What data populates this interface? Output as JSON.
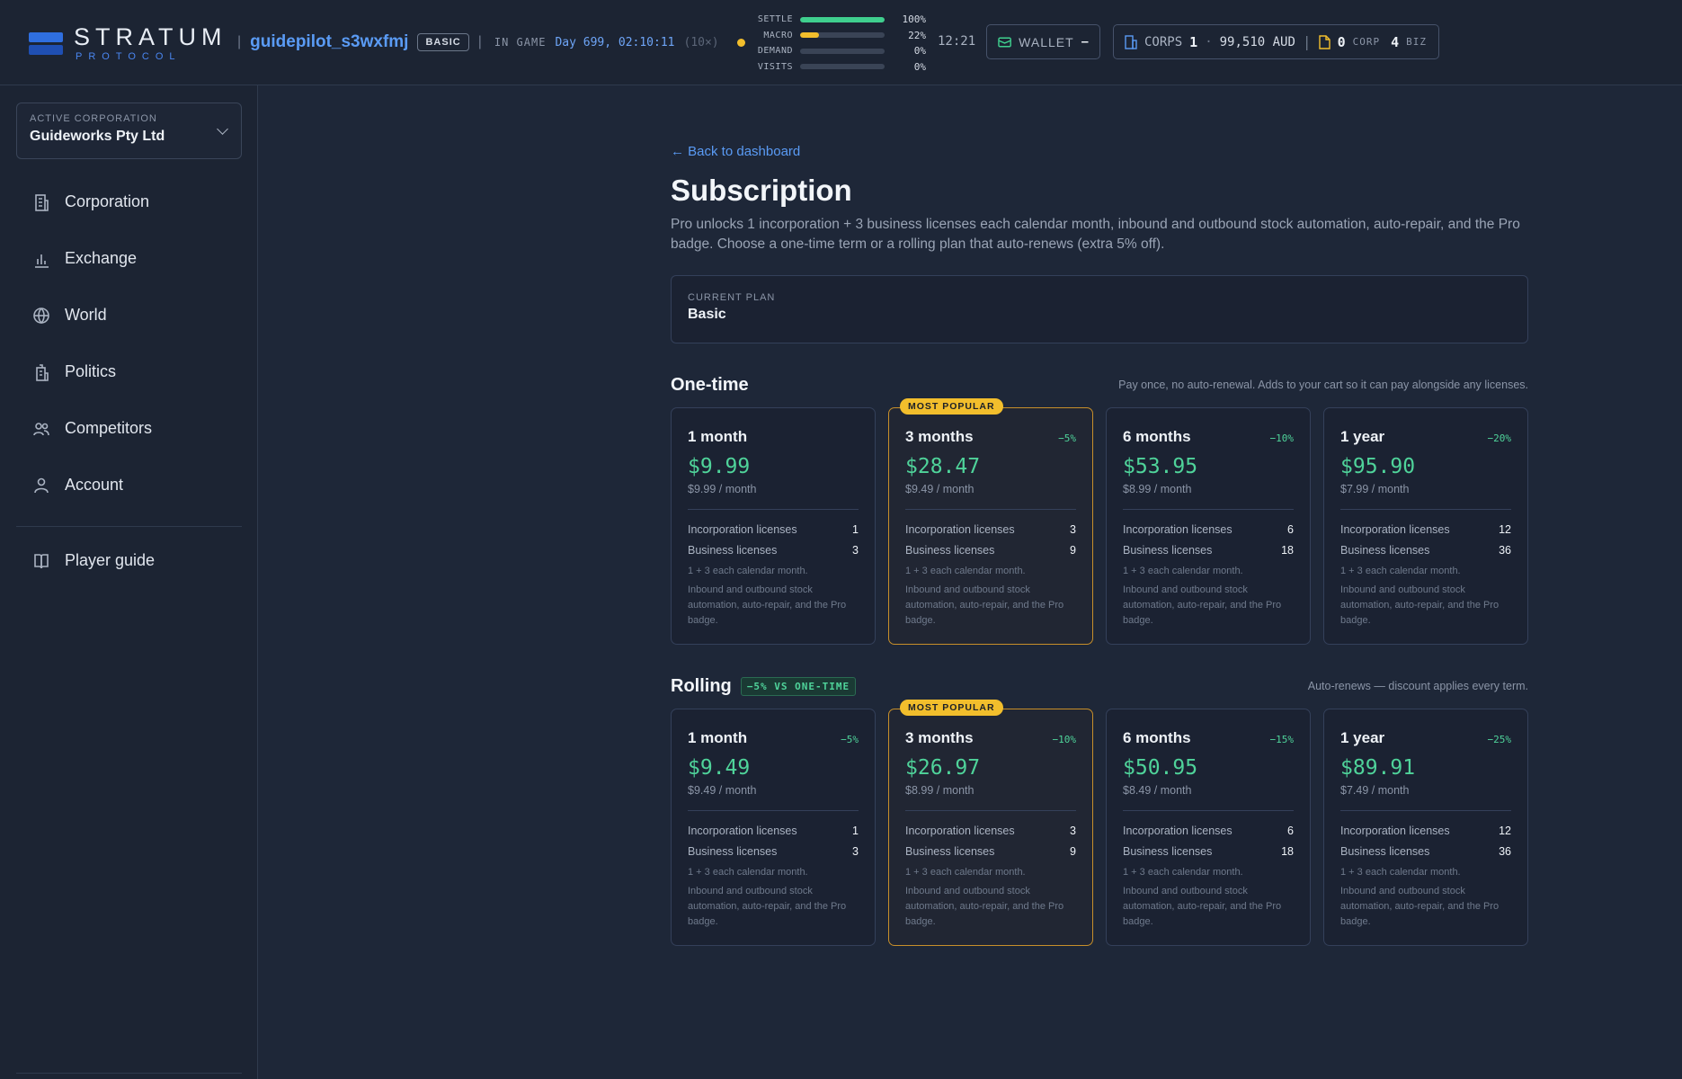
{
  "brand": {
    "name": "STRATUM",
    "sub": "PROTOCOL"
  },
  "header": {
    "username": "guidepilot_s3wxfmj",
    "plan_badge": "BASIC",
    "ingame_label": "IN GAME",
    "ingame_day": "Day 699, 02:10:11",
    "ingame_speed": "(10×)",
    "meters": [
      {
        "label": "SETTLE",
        "value_text": "100%",
        "value": 1.0,
        "color": "#3fcf8e"
      },
      {
        "label": "MACRO",
        "value_text": "22%",
        "value": 0.22,
        "color": "#f2be2c"
      },
      {
        "label": "DEMAND",
        "value_text": "0%",
        "value": 0.0,
        "color": "#3fcf8e"
      },
      {
        "label": "VISITS",
        "value_text": "0%",
        "value": 0.0,
        "color": "#3fcf8e"
      }
    ],
    "clock": "12:21",
    "wallet_label": "WALLET",
    "wallet_value": "–",
    "corps_label": "CORPS",
    "corps_count": "1",
    "corps_balance": "99,510 AUD",
    "corp_licenses": "0",
    "corp_unit": "CORP",
    "biz_licenses": "4",
    "biz_unit": "BIZ"
  },
  "sidebar": {
    "active_label": "ACTIVE CORPORATION",
    "active_value": "Guideworks Pty Ltd",
    "items": [
      {
        "label": "Corporation",
        "icon": "building-icon"
      },
      {
        "label": "Exchange",
        "icon": "bar-chart-icon"
      },
      {
        "label": "World",
        "icon": "globe-icon"
      },
      {
        "label": "Politics",
        "icon": "government-icon"
      },
      {
        "label": "Competitors",
        "icon": "users-icon"
      },
      {
        "label": "Account",
        "icon": "user-icon"
      }
    ],
    "guide": {
      "label": "Player guide",
      "icon": "book-icon"
    }
  },
  "main": {
    "back": "← Back to dashboard",
    "title": "Subscription",
    "description": "Pro unlocks 1 incorporation + 3 business licenses each calendar month, inbound and outbound stock automation, auto-repair, and the Pro badge. Choose a one-time term or a rolling plan that auto-renews (extra 5% off).",
    "current_plan_label": "CURRENT PLAN",
    "current_plan_value": "Basic",
    "inc_label": "Incorporation licenses",
    "biz_label": "Business licenses",
    "foot1": "1 + 3 each calendar month.",
    "foot2": "Inbound and outbound stock automation, auto-repair, and the Pro badge.",
    "popular_badge": "MOST POPULAR",
    "one_time": {
      "title": "One-time",
      "note": "Pay once, no auto-renewal. Adds to your cart so it can pay alongside any licenses.",
      "plans": [
        {
          "term": "1 month",
          "discount": "",
          "price": "$9.99",
          "per_month": "$9.99 / month",
          "inc": "1",
          "biz": "3",
          "popular": false
        },
        {
          "term": "3 months",
          "discount": "−5%",
          "price": "$28.47",
          "per_month": "$9.49 / month",
          "inc": "3",
          "biz": "9",
          "popular": true
        },
        {
          "term": "6 months",
          "discount": "−10%",
          "price": "$53.95",
          "per_month": "$8.99 / month",
          "inc": "6",
          "biz": "18",
          "popular": false
        },
        {
          "term": "1 year",
          "discount": "−20%",
          "price": "$95.90",
          "per_month": "$7.99 / month",
          "inc": "12",
          "biz": "36",
          "popular": false
        }
      ]
    },
    "rolling": {
      "title": "Rolling",
      "badge": "−5% VS ONE-TIME",
      "note": "Auto-renews — discount applies every term.",
      "plans": [
        {
          "term": "1 month",
          "discount": "−5%",
          "price": "$9.49",
          "per_month": "$9.49 / month",
          "inc": "1",
          "biz": "3",
          "popular": false
        },
        {
          "term": "3 months",
          "discount": "−10%",
          "price": "$26.97",
          "per_month": "$8.99 / month",
          "inc": "3",
          "biz": "9",
          "popular": true
        },
        {
          "term": "6 months",
          "discount": "−15%",
          "price": "$50.95",
          "per_month": "$8.49 / month",
          "inc": "6",
          "biz": "18",
          "popular": false
        },
        {
          "term": "1 year",
          "discount": "−25%",
          "price": "$89.91",
          "per_month": "$7.49 / month",
          "inc": "12",
          "biz": "36",
          "popular": false
        }
      ]
    }
  }
}
